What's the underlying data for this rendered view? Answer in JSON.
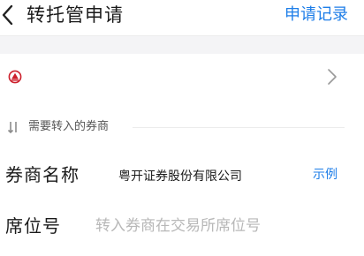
{
  "header": {
    "title": "转托管申请",
    "records_link": "申请记录"
  },
  "broker_selector": {
    "logo_icon": "broker-logo-icon",
    "accent_color": "#cc1f2b"
  },
  "section": {
    "label": "需要转入的券商"
  },
  "form": {
    "broker_name": {
      "label": "券商名称",
      "value": "粤开证券股份有限公司",
      "example_link": "示例"
    },
    "seat_number": {
      "label": "席位号",
      "placeholder": "转入券商在交易所席位号",
      "value": ""
    }
  },
  "colors": {
    "link": "#1e7ee8",
    "background_band": "#f4f4f6"
  }
}
